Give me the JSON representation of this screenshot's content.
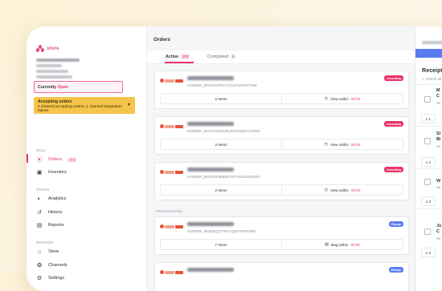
{
  "app": {
    "logo_text": "store",
    "accent_color": "#e8336a"
  },
  "sidebar": {
    "status_label": "Currently",
    "status_value": "Open",
    "alert_title": "Accepting orders",
    "alert_body": "2 channel accepting orders, 1 channel integration failure",
    "sections": {
      "sell": "SELL",
      "track": "TRACK",
      "manage": "MANAGE"
    },
    "items": {
      "orders": {
        "label": "Orders",
        "count": "373"
      },
      "inventory": {
        "label": "Inventory"
      },
      "analytics": {
        "label": "Analytics"
      },
      "history": {
        "label": "History"
      },
      "reports": {
        "label": "Reports"
      },
      "store": {
        "label": "Store"
      },
      "channels": {
        "label": "Channels"
      },
      "settings": {
        "label": "Settings"
      }
    }
  },
  "orders": {
    "title": "Orders",
    "tabs": [
      {
        "label": "Active",
        "count": "373"
      },
      {
        "label": "Completed",
        "count": "0"
      }
    ],
    "processing_label": "PROCESSING",
    "cards": [
      {
        "order_id": "#ORDER_0K2YDSPFEYCZV5Y5T6GPTEM",
        "status": "Incoming",
        "items": "2 Items",
        "action": "View within",
        "timer": "00:00"
      },
      {
        "order_id": "#ORDER_0K2YDSDSSZKJKCEG9ZFLCDWZ",
        "status": "Incoming",
        "items": "2 Items",
        "action": "View within",
        "timer": "00:00"
      },
      {
        "order_id": "#ORDER_0K2YDSNKB8GXXTVAEZ2FEDW3",
        "status": "Incoming",
        "items": "2 Items",
        "action": "View within",
        "timer": "00:00"
      },
      {
        "order_id": "#ORDER_0K3E6QQT7EKYQESTP637ZB6",
        "status": "Ready",
        "items": "7 Items",
        "action": "Bag within",
        "timer": "00:00"
      },
      {
        "order_id": "",
        "status": "Ready",
        "items": "",
        "action": "",
        "timer": ""
      }
    ]
  },
  "receipt": {
    "title": "Receipt",
    "check_label": "Check all",
    "items": [
      {
        "title_line1": "M",
        "title_line2": "C",
        "sub": "Su",
        "qty": "x 1"
      },
      {
        "title_line1": "Sl",
        "title_line2": "Bi",
        "sub": "Su",
        "qty": "x 2"
      },
      {
        "title_line1": "W",
        "title_line2": "",
        "sub": "Su",
        "qty": "x 2"
      },
      {
        "title_line1": "Jo",
        "title_line2": "C",
        "sub": "Su",
        "qty": "x 2"
      }
    ]
  }
}
